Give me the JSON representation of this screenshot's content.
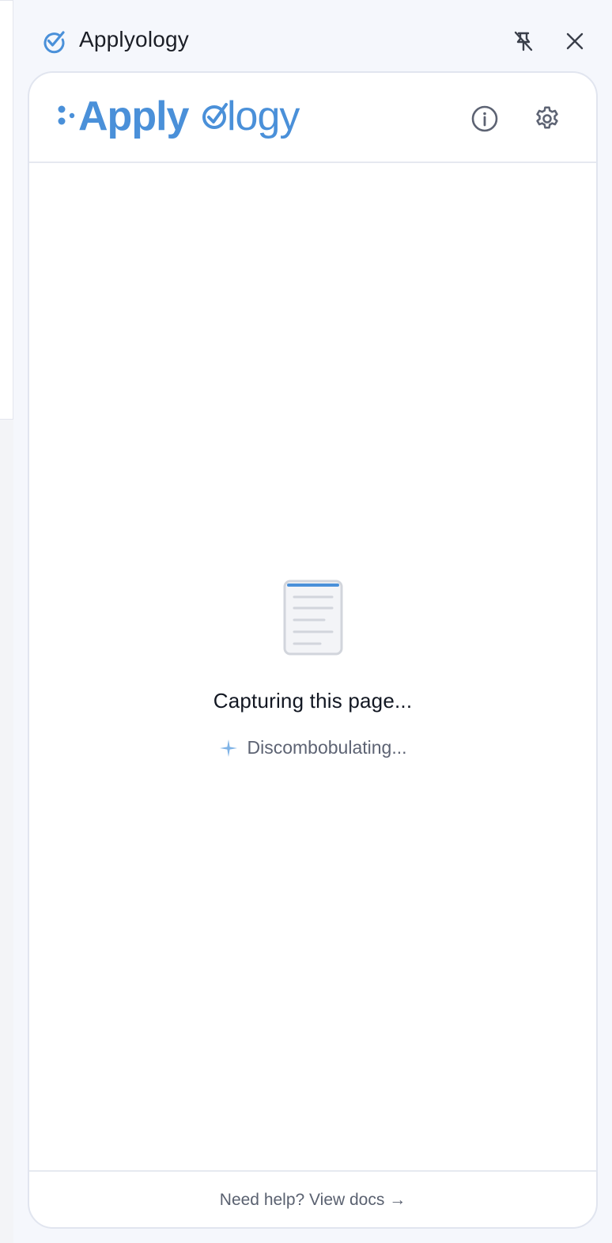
{
  "panel": {
    "title": "Applyology",
    "icons": {
      "app": "check-circle-icon",
      "unpin": "unpin-icon",
      "close": "close-icon"
    }
  },
  "card": {
    "logo_text": "Applyology",
    "icons": {
      "info": "info-icon",
      "settings": "gear-icon"
    }
  },
  "loading": {
    "icon": "document-icon",
    "title": "Capturing this page...",
    "status_icon": "sparkle-icon",
    "status": "Discombobulating..."
  },
  "footer": {
    "help_link": "Need help? View docs →"
  },
  "colors": {
    "brand_blue": "#4a90d9",
    "icon_gray": "#5d6373",
    "border": "#e1e5ef"
  }
}
